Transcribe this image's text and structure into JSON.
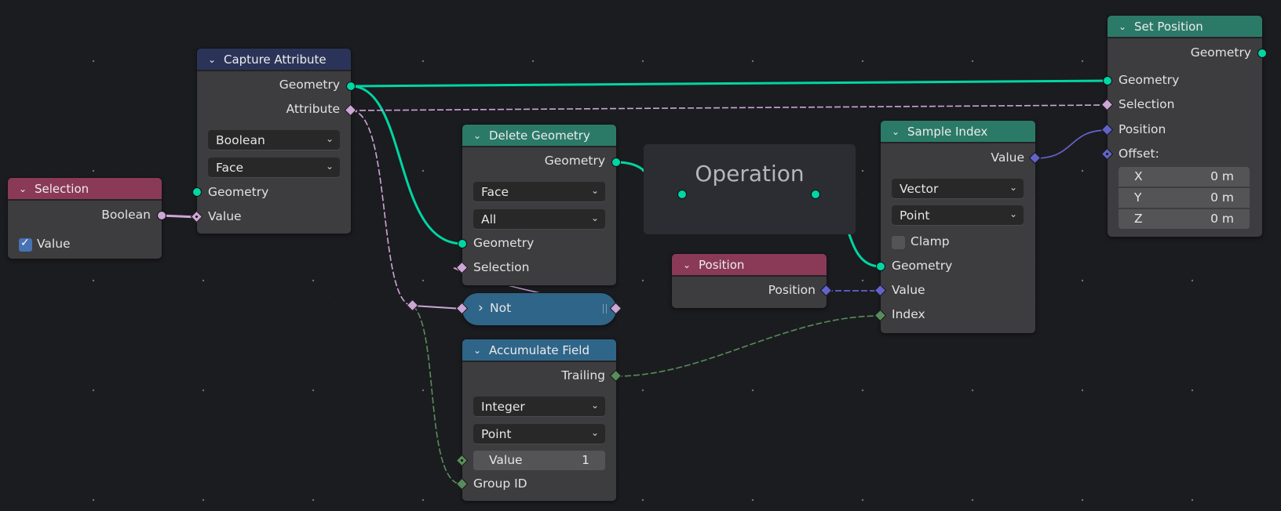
{
  "colors": {
    "background": "#1b1c20",
    "node_body": "#3d3d3f",
    "header_input": "#8a3a56",
    "header_attribute": "#2b3458",
    "header_geometry": "#2b7a68",
    "header_utility": "#2f6588",
    "socket_geometry": "#00d6a3",
    "socket_boolean": "#cca6d6",
    "socket_vector": "#6363c7",
    "socket_integer": "#598c5c",
    "frame": "#2b2d33"
  },
  "nodes": {
    "selection": {
      "title": "Selection",
      "output_boolean": "Boolean",
      "checkbox_label": "Value",
      "checkbox_checked": true
    },
    "capture_attribute": {
      "title": "Capture Attribute",
      "output_geometry": "Geometry",
      "output_attribute": "Attribute",
      "data_type": "Boolean",
      "domain": "Face",
      "input_geometry": "Geometry",
      "input_value": "Value"
    },
    "delete_geometry": {
      "title": "Delete Geometry",
      "output_geometry": "Geometry",
      "domain": "Face",
      "mode": "All",
      "input_geometry": "Geometry",
      "input_selection": "Selection"
    },
    "not": {
      "title": "Not"
    },
    "accumulate_field": {
      "title": "Accumulate Field",
      "output_trailing": "Trailing",
      "data_type": "Integer",
      "domain": "Point",
      "value_label": "Value",
      "value": "1",
      "input_group_id": "Group ID"
    },
    "frame": {
      "label": "Operation"
    },
    "position": {
      "title": "Position",
      "output_position": "Position"
    },
    "sample_index": {
      "title": "Sample Index",
      "output_value": "Value",
      "data_type": "Vector",
      "domain": "Point",
      "clamp_label": "Clamp",
      "clamp_checked": false,
      "input_geometry": "Geometry",
      "input_value": "Value",
      "input_index": "Index"
    },
    "set_position": {
      "title": "Set Position",
      "output_geometry": "Geometry",
      "input_geometry": "Geometry",
      "input_selection": "Selection",
      "input_position": "Position",
      "input_offset": "Offset:",
      "offset": [
        {
          "axis": "X",
          "value": "0 m"
        },
        {
          "axis": "Y",
          "value": "0 m"
        },
        {
          "axis": "Z",
          "value": "0 m"
        }
      ]
    }
  },
  "icons": {
    "collapse": "⌄",
    "expand": "›",
    "dropdown": "⌄",
    "check": "✓"
  }
}
